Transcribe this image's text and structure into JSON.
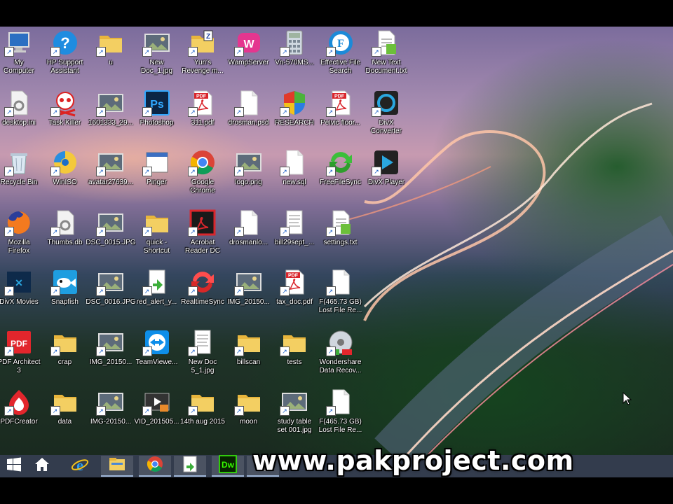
{
  "desktop": {
    "icons": [
      {
        "label": "My\nComputer",
        "icon": "computer-icon",
        "col": 0,
        "row": 0
      },
      {
        "label": "HP Support\nAssistant",
        "icon": "help-icon",
        "col": 1,
        "row": 0
      },
      {
        "label": "u",
        "icon": "folder-icon",
        "col": 2,
        "row": 0
      },
      {
        "label": "New\nDoc_1.jpg",
        "icon": "image-icon",
        "col": 3,
        "row": 0
      },
      {
        "label": "Yuri's\nRevenge m...",
        "icon": "zip-folder-icon",
        "col": 4,
        "row": 0
      },
      {
        "label": "WampServer",
        "icon": "wamp-icon",
        "col": 5,
        "row": 0
      },
      {
        "label": "Vn-570MS...",
        "icon": "calculator-icon",
        "col": 6,
        "row": 0
      },
      {
        "label": "Effective File\nSearch",
        "icon": "file-search-icon",
        "col": 7,
        "row": 0
      },
      {
        "label": "New Text\nDocument.txt",
        "icon": "text-document-icon",
        "col": 8,
        "row": 0
      },
      {
        "label": "desktop.ini",
        "icon": "settings-file-icon",
        "col": 0,
        "row": 1
      },
      {
        "label": "Task Killer",
        "icon": "skull-icon",
        "col": 1,
        "row": 1
      },
      {
        "label": "1601333_29...",
        "icon": "image-icon",
        "col": 2,
        "row": 1
      },
      {
        "label": "Photoshop",
        "icon": "photoshop-icon",
        "col": 3,
        "row": 1
      },
      {
        "label": "311.pdf",
        "icon": "pdf-icon",
        "col": 4,
        "row": 1
      },
      {
        "label": "drosman.psd",
        "icon": "blank-file-icon",
        "col": 5,
        "row": 1
      },
      {
        "label": "RESEARCH",
        "icon": "shield-icon",
        "col": 6,
        "row": 1
      },
      {
        "label": "Pelvic floor...",
        "icon": "pdf-icon",
        "col": 7,
        "row": 1
      },
      {
        "label": "DivX\nConverter",
        "icon": "divx-icon",
        "col": 8,
        "row": 1
      },
      {
        "label": "Recycle Bin",
        "icon": "recycle-bin-icon",
        "col": 0,
        "row": 2
      },
      {
        "label": "WinISO",
        "icon": "disc-icon",
        "col": 1,
        "row": 2
      },
      {
        "label": "avatar27639...",
        "icon": "image-icon",
        "col": 2,
        "row": 2
      },
      {
        "label": "Pinger",
        "icon": "app-window-icon",
        "col": 3,
        "row": 2
      },
      {
        "label": "Google\nChrome",
        "icon": "chrome-icon",
        "col": 4,
        "row": 2
      },
      {
        "label": "logo.png",
        "icon": "image-icon",
        "col": 5,
        "row": 2
      },
      {
        "label": "new.sql",
        "icon": "blank-file-icon",
        "col": 6,
        "row": 2
      },
      {
        "label": "FreeFileSync",
        "icon": "sync-green-icon",
        "col": 7,
        "row": 2
      },
      {
        "label": "DivX Player",
        "icon": "play-icon",
        "col": 8,
        "row": 2
      },
      {
        "label": "Mozilla\nFirefox",
        "icon": "firefox-icon",
        "col": 0,
        "row": 3
      },
      {
        "label": "Thumbs.db",
        "icon": "settings-file-icon",
        "col": 1,
        "row": 3
      },
      {
        "label": "DSC_0015.JPG",
        "icon": "image-icon",
        "col": 2,
        "row": 3
      },
      {
        "label": "quick -\nShortcut",
        "icon": "folder-icon",
        "col": 3,
        "row": 3
      },
      {
        "label": "Acrobat\nReader DC",
        "icon": "acrobat-icon",
        "col": 4,
        "row": 3
      },
      {
        "label": "drosmanlo...",
        "icon": "blank-file-icon",
        "col": 5,
        "row": 3
      },
      {
        "label": "bill29sept_...",
        "icon": "document-icon",
        "col": 6,
        "row": 3
      },
      {
        "label": "settings.txt",
        "icon": "text-document-icon",
        "col": 7,
        "row": 3
      },
      {
        "label": "DivX Movies",
        "icon": "divx-movies-icon",
        "col": 0,
        "row": 4
      },
      {
        "label": "Snapfish",
        "icon": "fish-icon",
        "col": 1,
        "row": 4
      },
      {
        "label": "DSC_0016.JPG",
        "icon": "image-icon",
        "col": 2,
        "row": 4
      },
      {
        "label": "red_alert_y...",
        "icon": "installer-icon",
        "col": 3,
        "row": 4
      },
      {
        "label": "RealtimeSync",
        "icon": "sync-red-icon",
        "col": 4,
        "row": 4
      },
      {
        "label": "IMG_20150...",
        "icon": "image-icon",
        "col": 5,
        "row": 4
      },
      {
        "label": "tax_doc.pdf",
        "icon": "pdf-icon",
        "col": 6,
        "row": 4
      },
      {
        "label": "F(465.73 GB)\nLost File Re...",
        "icon": "blank-file-icon",
        "col": 7,
        "row": 4
      },
      {
        "label": "PDF Architect\n3",
        "icon": "pdf-architect-icon",
        "col": 0,
        "row": 5
      },
      {
        "label": "crap",
        "icon": "folder-icon",
        "col": 1,
        "row": 5
      },
      {
        "label": "IMG_20150...",
        "icon": "image-icon",
        "col": 2,
        "row": 5
      },
      {
        "label": "TeamViewe...",
        "icon": "teamviewer-icon",
        "col": 3,
        "row": 5
      },
      {
        "label": "New Doc\n5_1.jpg",
        "icon": "document-icon",
        "col": 4,
        "row": 5
      },
      {
        "label": "billscan",
        "icon": "folder-icon",
        "col": 5,
        "row": 5
      },
      {
        "label": "tests",
        "icon": "folder-icon",
        "col": 6,
        "row": 5
      },
      {
        "label": "Wondershare\nData Recov...",
        "icon": "recovery-icon",
        "col": 7,
        "row": 5
      },
      {
        "label": "PDFCreator",
        "icon": "pdfcreator-icon",
        "col": 0,
        "row": 6
      },
      {
        "label": "data",
        "icon": "folder-icon",
        "col": 1,
        "row": 6
      },
      {
        "label": "IMG-20150...",
        "icon": "image-icon",
        "col": 2,
        "row": 6
      },
      {
        "label": "VID_201505...",
        "icon": "video-icon",
        "col": 3,
        "row": 6
      },
      {
        "label": "14th aug 2015",
        "icon": "folder-icon",
        "col": 4,
        "row": 6
      },
      {
        "label": "moon",
        "icon": "folder-icon",
        "col": 5,
        "row": 6
      },
      {
        "label": "study table\nset 001.jpg",
        "icon": "image-icon",
        "col": 6,
        "row": 6
      },
      {
        "label": "F(465.73 GB)\nLost File Re...",
        "icon": "blank-file-icon",
        "col": 7,
        "row": 6
      }
    ]
  },
  "taskbar": {
    "buttons": [
      {
        "name": "start-button",
        "icon": "windows-logo-icon"
      },
      {
        "name": "home-button",
        "icon": "home-icon"
      },
      {
        "name": "internet-explorer-button",
        "icon": "ie-icon"
      },
      {
        "name": "file-explorer-button",
        "icon": "file-explorer-icon"
      },
      {
        "name": "chrome-button",
        "icon": "chrome-icon"
      },
      {
        "name": "installer-button",
        "icon": "installer-icon"
      },
      {
        "name": "dreamweaver-button",
        "icon": "dreamweaver-icon",
        "text": "Dw"
      },
      {
        "name": "window-button",
        "icon": "window-icon"
      }
    ]
  },
  "watermark": "www.pakproject.com",
  "colors": {
    "pdf_red": "#d9262c",
    "folder_yellow": "#f3cf62",
    "photoshop_blue": "#0b2545",
    "taskbar": "#3c465a"
  }
}
